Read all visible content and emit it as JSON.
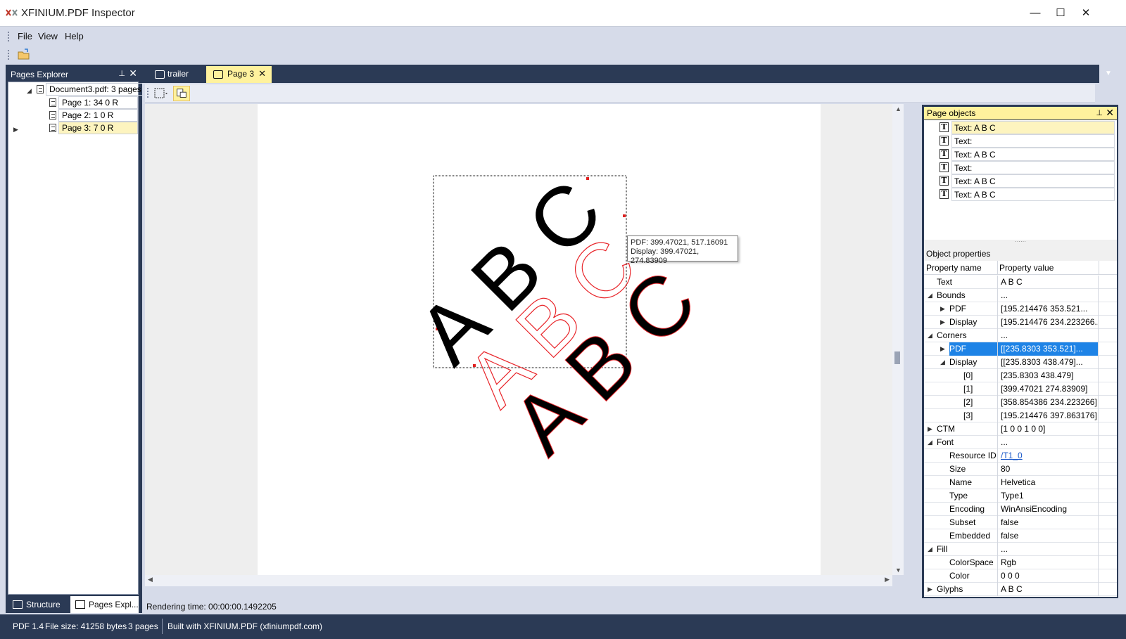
{
  "window": {
    "title": "XFINIUM.PDF Inspector",
    "minimize": "—",
    "maximize": "☐",
    "close": "✕"
  },
  "menu": [
    "File",
    "View",
    "Help"
  ],
  "pages_explorer": {
    "title": "Pages Explorer",
    "pin": "📌",
    "close": "✕",
    "document": "Document3.pdf: 3 pages",
    "pages": [
      "Page 1: 34 0 R",
      "Page 2: 1 0 R",
      "Page 3: 7 0 R"
    ],
    "selected_index": 2,
    "bottom_tabs": [
      "Structure ...",
      "Pages Expl..."
    ]
  },
  "doc_tabs": [
    {
      "label": "trailer",
      "active": false
    },
    {
      "label": "Page 3",
      "active": true
    }
  ],
  "doc_tab_close": "✕",
  "dropdown_glyph": "▼",
  "tooltip": {
    "line1": "PDF: 399.47021, 517.16091",
    "line2": "Display: 399.47021, 274.83909"
  },
  "canvas_text": "A B C",
  "render_time": "Rendering time: 00:00:00.1492205",
  "page_objects": {
    "title": "Page objects",
    "items": [
      "Text: A B C",
      "Text:",
      "Text: A B C",
      "Text:",
      "Text: A B C",
      "Text: A B C"
    ],
    "selected_index": 0
  },
  "object_properties": {
    "title": "Object properties",
    "col_name": "Property name",
    "col_value": "Property value",
    "rows": [
      {
        "name": "Text",
        "value": "A B C",
        "level": 0,
        "exp": ""
      },
      {
        "name": "Bounds",
        "value": "...",
        "level": 0,
        "exp": "open"
      },
      {
        "name": "PDF",
        "value": "[195.214476 353.521...",
        "level": 1,
        "exp": "closed"
      },
      {
        "name": "Display",
        "value": "[195.214476 234.223266...",
        "level": 1,
        "exp": "closed"
      },
      {
        "name": "Corners",
        "value": "...",
        "level": 0,
        "exp": "open"
      },
      {
        "name": "PDF",
        "value": "[[235.8303 353.521]...",
        "level": 1,
        "exp": "closed",
        "selected": true
      },
      {
        "name": "Display",
        "value": "[[235.8303 438.479]...",
        "level": 1,
        "exp": "open"
      },
      {
        "name": "[0]",
        "value": "[235.8303 438.479]",
        "level": 2,
        "exp": ""
      },
      {
        "name": "[1]",
        "value": "[399.47021 274.83909]",
        "level": 2,
        "exp": ""
      },
      {
        "name": "[2]",
        "value": "[358.854386 234.223266]",
        "level": 2,
        "exp": ""
      },
      {
        "name": "[3]",
        "value": "[195.214476 397.863176]",
        "level": 2,
        "exp": ""
      },
      {
        "name": "CTM",
        "value": "[1 0 0 1 0 0]",
        "level": 0,
        "exp": "closed"
      },
      {
        "name": "Font",
        "value": "...",
        "level": 0,
        "exp": "open"
      },
      {
        "name": "Resource ID",
        "value": "/T1_0",
        "level": 1,
        "exp": "",
        "link": true
      },
      {
        "name": "Size",
        "value": "80",
        "level": 1,
        "exp": ""
      },
      {
        "name": "Name",
        "value": "Helvetica",
        "level": 1,
        "exp": ""
      },
      {
        "name": "Type",
        "value": "Type1",
        "level": 1,
        "exp": ""
      },
      {
        "name": "Encoding",
        "value": "WinAnsiEncoding",
        "level": 1,
        "exp": ""
      },
      {
        "name": "Subset",
        "value": "false",
        "level": 1,
        "exp": ""
      },
      {
        "name": "Embedded",
        "value": "false",
        "level": 1,
        "exp": ""
      },
      {
        "name": "Fill",
        "value": "...",
        "level": 0,
        "exp": "open"
      },
      {
        "name": "ColorSpace",
        "value": "Rgb",
        "level": 1,
        "exp": ""
      },
      {
        "name": "Color",
        "value": "0 0 0",
        "level": 1,
        "exp": ""
      },
      {
        "name": "Glyphs",
        "value": "A B C",
        "level": 0,
        "exp": "closed"
      }
    ]
  },
  "status": {
    "pdf_version": "PDF 1.4",
    "file_size": "File size: 41258 bytes",
    "pages": "3 pages",
    "built_with": "Built with XFINIUM.PDF (xfiniumpdf.com)"
  },
  "colors": {
    "chrome": "#2b3a55",
    "accent": "#fff29d",
    "selection": "#1e83e6",
    "outline_text": "#e8262b"
  }
}
